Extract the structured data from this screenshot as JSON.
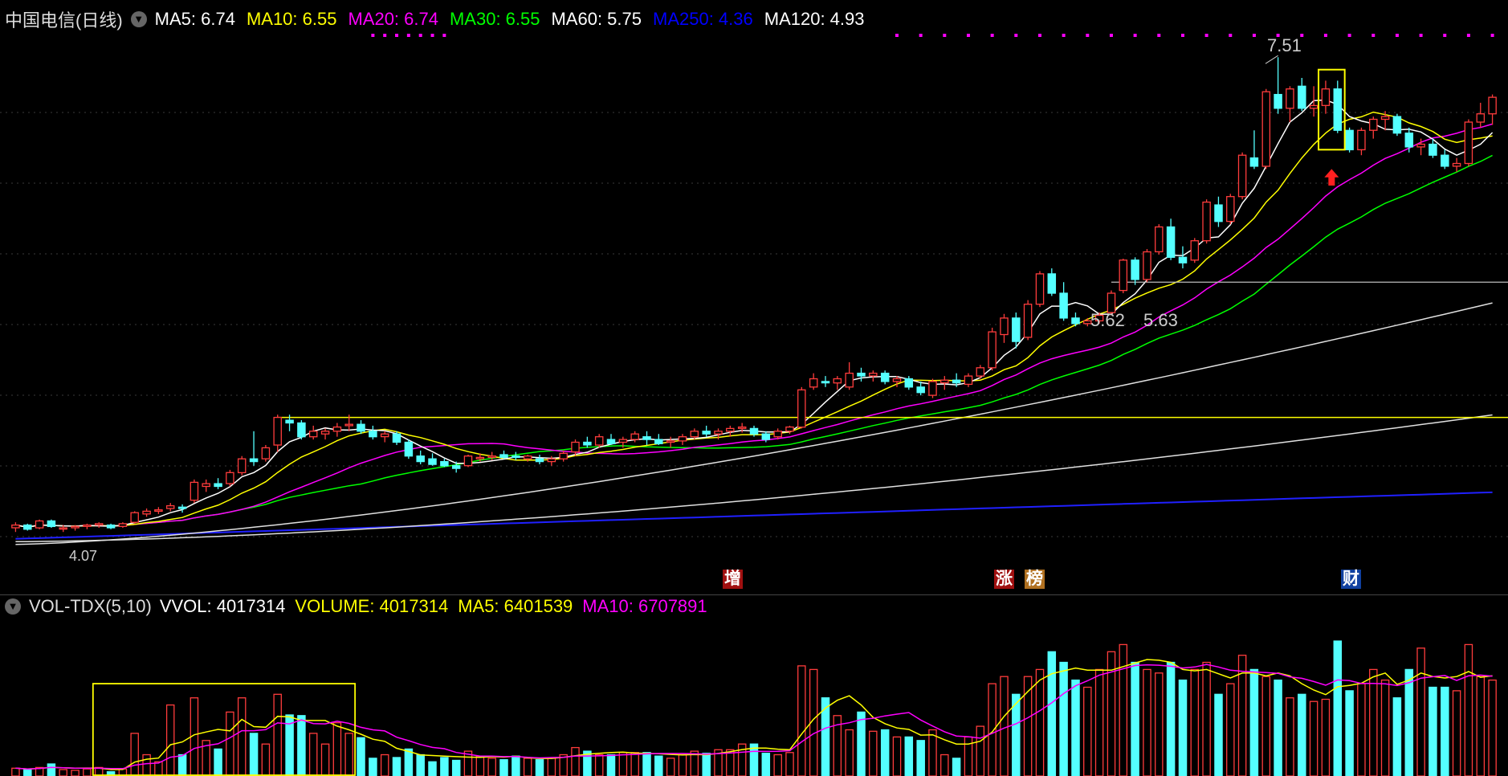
{
  "header": {
    "stock": "中国电信(日线)",
    "ma_items": [
      {
        "label": "MA5: 6.74",
        "color": "#ffffff"
      },
      {
        "label": "MA10: 6.55",
        "color": "#ffff00"
      },
      {
        "label": "MA20: 6.74",
        "color": "#ff00ff"
      },
      {
        "label": "MA30: 6.55",
        "color": "#00ff00"
      },
      {
        "label": "MA60: 5.75",
        "color": "#ffffff"
      },
      {
        "label": "MA250: 4.36",
        "color": "#0000ff"
      },
      {
        "label": "MA120: 4.93",
        "color": "#ffffff"
      }
    ]
  },
  "volume_header": {
    "indicator": "VOL-TDX(5,10)",
    "items": [
      {
        "label": "VVOL: 4017314",
        "color": "#ffffff"
      },
      {
        "label": "VOLUME: 4017314",
        "color": "#ffff00"
      },
      {
        "label": "MA5: 6401539",
        "color": "#ffff00"
      },
      {
        "label": "MA10: 6707891",
        "color": "#ff00ff"
      }
    ]
  },
  "annotations": {
    "high_label": "7.51",
    "low_label": "4.07",
    "mid_label_1": "5.62",
    "mid_label_2": "5.63"
  },
  "events": [
    {
      "text": "增",
      "bg": "#a01010",
      "fg": "#ffffff"
    },
    {
      "text": "涨",
      "bg": "#a01010",
      "fg": "#ffffff"
    },
    {
      "text": "榜",
      "bg": "#b07020",
      "fg": "#ffffff"
    },
    {
      "text": "财",
      "bg": "#1040a0",
      "fg": "#ffffff"
    }
  ],
  "chart_data": {
    "type": "candlestick",
    "price_range": [
      3.85,
      7.75
    ],
    "volume_max": 19000000,
    "candles": [
      [
        4.1,
        4.14,
        4.07,
        4.12,
        1100000
      ],
      [
        4.12,
        4.13,
        4.08,
        4.09,
        900000
      ],
      [
        4.1,
        4.16,
        4.09,
        4.15,
        1200000
      ],
      [
        4.15,
        4.16,
        4.1,
        4.11,
        1700000
      ],
      [
        4.1,
        4.12,
        4.07,
        4.1,
        900000
      ],
      [
        4.1,
        4.12,
        4.08,
        4.11,
        800000
      ],
      [
        4.11,
        4.13,
        4.09,
        4.12,
        1000000
      ],
      [
        4.12,
        4.14,
        4.1,
        4.13,
        1200000
      ],
      [
        4.12,
        4.13,
        4.09,
        4.1,
        600000
      ],
      [
        4.11,
        4.14,
        4.1,
        4.13,
        1000000
      ],
      [
        4.14,
        4.22,
        4.13,
        4.21,
        6000000
      ],
      [
        4.2,
        4.24,
        4.18,
        4.22,
        3000000
      ],
      [
        4.22,
        4.25,
        4.2,
        4.23,
        2000000
      ],
      [
        4.24,
        4.28,
        4.22,
        4.26,
        10000000
      ],
      [
        4.25,
        4.27,
        4.21,
        4.24,
        3000000
      ],
      [
        4.3,
        4.45,
        4.28,
        4.43,
        11000000
      ],
      [
        4.4,
        4.45,
        4.36,
        4.42,
        5000000
      ],
      [
        4.42,
        4.46,
        4.38,
        4.4,
        3800000
      ],
      [
        4.42,
        4.52,
        4.4,
        4.5,
        9000000
      ],
      [
        4.5,
        4.62,
        4.48,
        4.6,
        11000000
      ],
      [
        4.6,
        4.8,
        4.55,
        4.58,
        6000000
      ],
      [
        4.6,
        4.7,
        4.58,
        4.68,
        4500000
      ],
      [
        4.7,
        4.92,
        4.65,
        4.9,
        11500000
      ],
      [
        4.88,
        4.92,
        4.8,
        4.86,
        8600000
      ],
      [
        4.86,
        4.88,
        4.74,
        4.76,
        8500000
      ],
      [
        4.76,
        4.84,
        4.74,
        4.8,
        6000000
      ],
      [
        4.78,
        4.82,
        4.74,
        4.8,
        4500000
      ],
      [
        4.8,
        4.86,
        4.76,
        4.83,
        7500000
      ],
      [
        4.84,
        4.92,
        4.8,
        4.85,
        6000000
      ],
      [
        4.85,
        4.88,
        4.78,
        4.8,
        5400000
      ],
      [
        4.8,
        4.84,
        4.74,
        4.76,
        2500000
      ],
      [
        4.76,
        4.8,
        4.72,
        4.78,
        3000000
      ],
      [
        4.78,
        4.8,
        4.7,
        4.72,
        2600000
      ],
      [
        4.72,
        4.74,
        4.6,
        4.62,
        3800000
      ],
      [
        4.62,
        4.66,
        4.56,
        4.58,
        3000000
      ],
      [
        4.6,
        4.64,
        4.55,
        4.56,
        2000000
      ],
      [
        4.58,
        4.6,
        4.54,
        4.55,
        2600000
      ],
      [
        4.55,
        4.58,
        4.5,
        4.53,
        2200000
      ],
      [
        4.55,
        4.63,
        4.54,
        4.62,
        3500000
      ],
      [
        4.6,
        4.64,
        4.58,
        4.61,
        2800000
      ],
      [
        4.61,
        4.65,
        4.59,
        4.62,
        2500000
      ],
      [
        4.63,
        4.66,
        4.6,
        4.61,
        2300000
      ],
      [
        4.62,
        4.65,
        4.59,
        4.61,
        2800000
      ],
      [
        4.6,
        4.63,
        4.58,
        4.62,
        2500000
      ],
      [
        4.6,
        4.63,
        4.56,
        4.58,
        2300000
      ],
      [
        4.58,
        4.62,
        4.55,
        4.6,
        2500000
      ],
      [
        4.6,
        4.66,
        4.58,
        4.64,
        3000000
      ],
      [
        4.65,
        4.74,
        4.62,
        4.72,
        4000000
      ],
      [
        4.72,
        4.76,
        4.68,
        4.7,
        3500000
      ],
      [
        4.7,
        4.78,
        4.68,
        4.76,
        3000000
      ],
      [
        4.74,
        4.78,
        4.7,
        4.71,
        3000000
      ],
      [
        4.72,
        4.76,
        4.68,
        4.74,
        3300000
      ],
      [
        4.74,
        4.8,
        4.72,
        4.78,
        3300000
      ],
      [
        4.76,
        4.8,
        4.7,
        4.74,
        3300000
      ],
      [
        4.74,
        4.78,
        4.7,
        4.71,
        2800000
      ],
      [
        4.72,
        4.76,
        4.68,
        4.73,
        2500000
      ],
      [
        4.73,
        4.78,
        4.7,
        4.76,
        3000000
      ],
      [
        4.76,
        4.82,
        4.74,
        4.8,
        3500000
      ],
      [
        4.8,
        4.84,
        4.76,
        4.78,
        3200000
      ],
      [
        4.78,
        4.82,
        4.74,
        4.8,
        3700000
      ],
      [
        4.8,
        4.84,
        4.76,
        4.82,
        3700000
      ],
      [
        4.82,
        4.86,
        4.79,
        4.83,
        4500000
      ],
      [
        4.82,
        4.84,
        4.76,
        4.78,
        4500000
      ],
      [
        4.78,
        4.8,
        4.72,
        4.74,
        3200000
      ],
      [
        4.76,
        4.82,
        4.74,
        4.8,
        3000000
      ],
      [
        4.8,
        4.84,
        4.78,
        4.83,
        3300000
      ],
      [
        4.83,
        5.12,
        4.82,
        5.1,
        15500000
      ],
      [
        5.12,
        5.22,
        5.1,
        5.18,
        15000000
      ],
      [
        5.16,
        5.2,
        5.12,
        5.15,
        11000000
      ],
      [
        5.15,
        5.2,
        5.1,
        5.18,
        8500000
      ],
      [
        5.12,
        5.3,
        5.1,
        5.22,
        6500000
      ],
      [
        5.22,
        5.26,
        5.16,
        5.2,
        9000000
      ],
      [
        5.2,
        5.24,
        5.16,
        5.22,
        6300000
      ],
      [
        5.22,
        5.24,
        5.14,
        5.16,
        6500000
      ],
      [
        5.16,
        5.2,
        5.12,
        5.18,
        5500000
      ],
      [
        5.18,
        5.2,
        5.1,
        5.12,
        5500000
      ],
      [
        5.12,
        5.16,
        5.06,
        5.08,
        5000000
      ],
      [
        5.06,
        5.18,
        5.04,
        5.16,
        6500000
      ],
      [
        5.15,
        5.2,
        5.1,
        5.17,
        3000000
      ],
      [
        5.17,
        5.22,
        5.12,
        5.15,
        2500000
      ],
      [
        5.14,
        5.22,
        5.12,
        5.2,
        5500000
      ],
      [
        5.2,
        5.28,
        5.18,
        5.26,
        7000000
      ],
      [
        5.26,
        5.55,
        5.24,
        5.52,
        13000000
      ],
      [
        5.5,
        5.65,
        5.44,
        5.62,
        14000000
      ],
      [
        5.62,
        5.66,
        5.4,
        5.45,
        11500000
      ],
      [
        5.48,
        5.75,
        5.46,
        5.72,
        14000000
      ],
      [
        5.72,
        5.96,
        5.7,
        5.94,
        15000000
      ],
      [
        5.94,
        5.98,
        5.78,
        5.8,
        17500000
      ],
      [
        5.8,
        5.88,
        5.6,
        5.62,
        16000000
      ],
      [
        5.62,
        5.66,
        5.56,
        5.58,
        13500000
      ],
      [
        5.58,
        5.62,
        5.56,
        5.6,
        12500000
      ],
      [
        5.6,
        5.66,
        5.58,
        5.64,
        15000000
      ],
      [
        5.66,
        5.82,
        5.64,
        5.8,
        17500000
      ],
      [
        5.82,
        6.05,
        5.8,
        6.04,
        18500000
      ],
      [
        6.04,
        6.06,
        5.86,
        5.9,
        16000000
      ],
      [
        5.9,
        6.12,
        5.88,
        6.1,
        15000000
      ],
      [
        6.1,
        6.3,
        6.08,
        6.28,
        14500000
      ],
      [
        6.28,
        6.34,
        6.04,
        6.06,
        16000000
      ],
      [
        6.06,
        6.14,
        5.98,
        6.02,
        13500000
      ],
      [
        6.04,
        6.2,
        6.02,
        6.18,
        15000000
      ],
      [
        6.18,
        6.48,
        6.16,
        6.46,
        16000000
      ],
      [
        6.44,
        6.5,
        6.28,
        6.32,
        11500000
      ],
      [
        6.32,
        6.52,
        6.3,
        6.5,
        13000000
      ],
      [
        6.5,
        6.82,
        6.48,
        6.8,
        17000000
      ],
      [
        6.78,
        6.98,
        6.7,
        6.72,
        15000000
      ],
      [
        6.72,
        7.28,
        6.7,
        7.26,
        14000000
      ],
      [
        7.24,
        7.51,
        7.1,
        7.14,
        13500000
      ],
      [
        7.14,
        7.3,
        7.04,
        7.28,
        11000000
      ],
      [
        7.3,
        7.36,
        7.12,
        7.14,
        11500000
      ],
      [
        7.14,
        7.3,
        7.08,
        7.16,
        10500000
      ],
      [
        7.16,
        7.34,
        7.1,
        7.28,
        10800000
      ],
      [
        7.28,
        7.34,
        6.96,
        6.98,
        19000000
      ],
      [
        6.98,
        7.0,
        6.82,
        6.84,
        12000000
      ],
      [
        6.84,
        7.0,
        6.8,
        6.98,
        13000000
      ],
      [
        6.98,
        7.08,
        6.92,
        7.06,
        15000000
      ],
      [
        7.06,
        7.12,
        6.98,
        7.08,
        13500000
      ],
      [
        7.08,
        7.1,
        6.94,
        6.96,
        11000000
      ],
      [
        6.96,
        7.0,
        6.82,
        6.86,
        15000000
      ],
      [
        6.86,
        6.92,
        6.8,
        6.88,
        18000000
      ],
      [
        6.88,
        6.92,
        6.78,
        6.8,
        12500000
      ],
      [
        6.8,
        6.84,
        6.7,
        6.72,
        12500000
      ],
      [
        6.72,
        6.78,
        6.68,
        6.74,
        12000000
      ],
      [
        6.74,
        7.06,
        6.72,
        7.04,
        18500000
      ],
      [
        7.04,
        7.18,
        7.0,
        7.1,
        14000000
      ],
      [
        7.1,
        7.24,
        7.02,
        7.22,
        13500000
      ]
    ]
  }
}
